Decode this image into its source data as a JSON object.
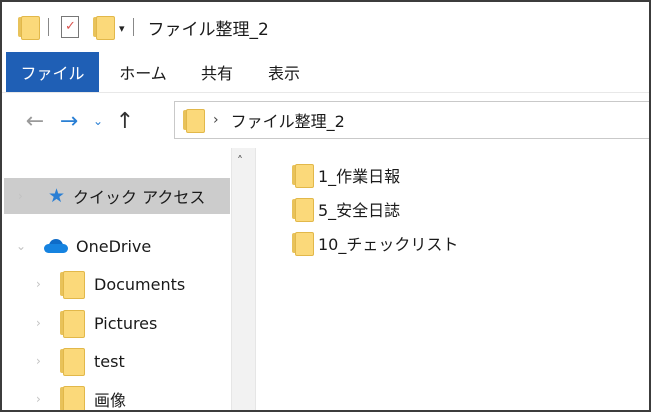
{
  "window": {
    "title": "ファイル整理_2",
    "qat_dropdown": "▾"
  },
  "ribbon": {
    "tabs": [
      "ファイル",
      "ホーム",
      "共有",
      "表示"
    ]
  },
  "navigation": {
    "back": "←",
    "forward": "→",
    "recent": "⌄",
    "up": "↑"
  },
  "address_bar": {
    "separator": "›",
    "path": "ファイル整理_2"
  },
  "nav_pane": {
    "quick_access": {
      "label": "クイック アクセス",
      "selected": true
    },
    "onedrive": {
      "label": "OneDrive"
    },
    "folders": [
      "Documents",
      "Pictures",
      "test",
      "画像"
    ]
  },
  "scrollbar": {
    "up_arrow": "˄"
  },
  "content": {
    "items": [
      "1_作業日報",
      "5_安全日誌",
      "10_チェックリスト"
    ]
  },
  "colors": {
    "file_tab": "#1f5fb5",
    "selection": "#cccccc",
    "folder": "#fbd97a",
    "accent": "#2a7fd4"
  },
  "icons": {
    "quick_access": "star-icon",
    "onedrive": "cloud-icon",
    "folder": "folder-icon",
    "properties": "properties-check-icon"
  }
}
